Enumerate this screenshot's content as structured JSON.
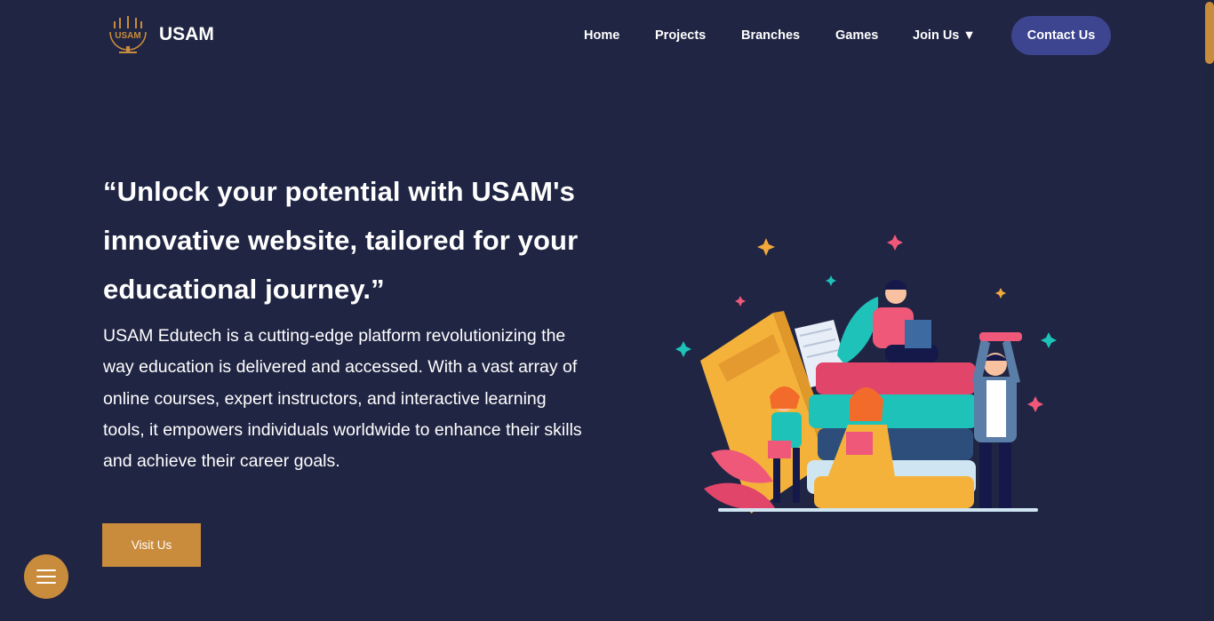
{
  "header": {
    "brand": "USAM",
    "logo_text": "USAM",
    "nav": [
      {
        "label": "Home"
      },
      {
        "label": "Projects"
      },
      {
        "label": "Branches"
      },
      {
        "label": "Games"
      },
      {
        "label": "Join Us ▼"
      }
    ],
    "contact_label": "Contact Us"
  },
  "hero": {
    "headline": "“Unlock your potential with USAM's innovative website, tailored for your educational journey.”",
    "description": "USAM Edutech is a cutting-edge platform revolutionizing the way education is delivered and accessed. With a vast array of online courses, expert instructors, and interactive learning tools, it empowers individuals worldwide to enhance their skills and achieve their career goals.",
    "cta_label": "Visit Us"
  },
  "colors": {
    "background": "#202543",
    "accent": "#c98b3c",
    "contact_button": "#3d4590"
  },
  "icons": {
    "floating_button": "hamburger-menu-icon",
    "logo": "usam-logo-icon"
  }
}
